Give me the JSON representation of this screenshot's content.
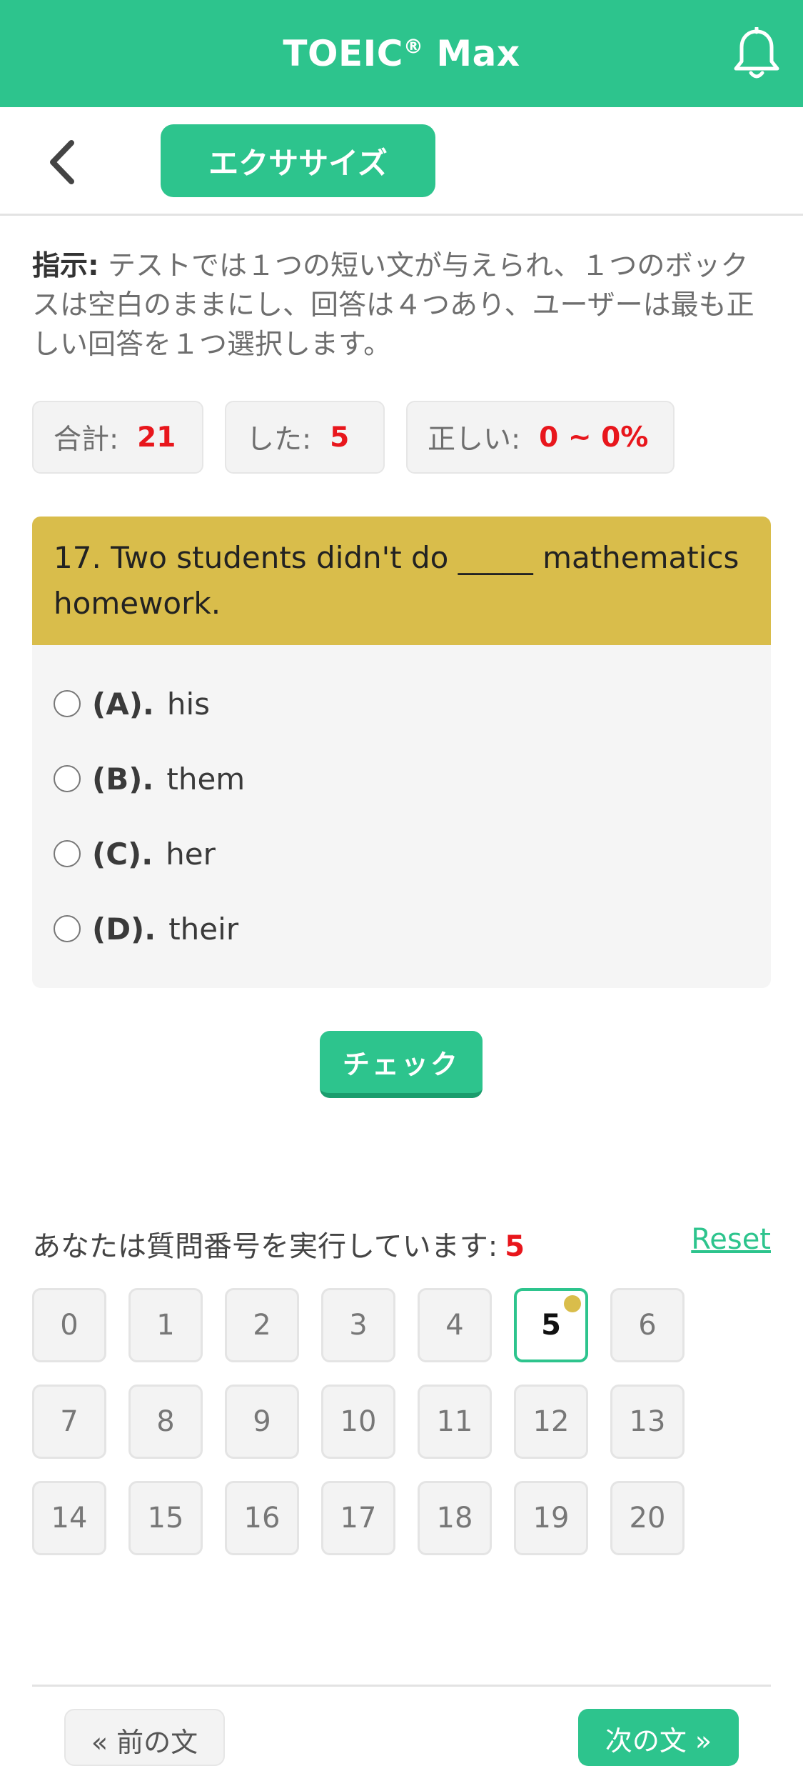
{
  "header": {
    "title": "TOEIC",
    "title_mark": "®",
    "title_suffix": " Max",
    "notification_icon": "bell-icon"
  },
  "subbar": {
    "back_icon": "chevron-left-icon",
    "exercise_label": "エクササイズ"
  },
  "instructions": {
    "label": "指示:",
    "text": " テストでは１つの短い文が与えられ、１つのボックスは空白のままにし、回答は４つあり、ユーザーは最も正しい回答を１つ選択します。"
  },
  "stats": {
    "total_label": "合計:",
    "total_value": "21",
    "done_label": "した:",
    "done_value": "5",
    "correct_label": "正しい:",
    "correct_value": "0 ~ 0%"
  },
  "question": {
    "text": "17. Two students didn't do _____ mathematics homework.",
    "options": [
      {
        "letter": "(A).",
        "text": "his"
      },
      {
        "letter": "(B).",
        "text": "them"
      },
      {
        "letter": "(C).",
        "text": "her"
      },
      {
        "letter": "(D).",
        "text": "their"
      }
    ]
  },
  "check_label": "チェック",
  "progress": {
    "label": "あなたは質問番号を実行しています:",
    "current": "5",
    "reset_label": "Reset"
  },
  "numbers": [
    "0",
    "1",
    "2",
    "3",
    "4",
    "5",
    "6",
    "7",
    "8",
    "9",
    "10",
    "11",
    "12",
    "13",
    "14",
    "15",
    "16",
    "17",
    "18",
    "19",
    "20"
  ],
  "nav": {
    "prev_label": "« 前の文",
    "next_label": "次の文 »"
  },
  "colors": {
    "accent": "#2dc48d",
    "question_bg": "#d9bd4b",
    "highlight": "#e8161c"
  }
}
